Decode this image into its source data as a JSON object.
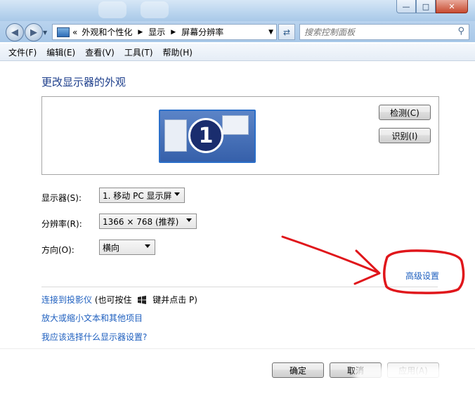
{
  "address": {
    "prefix": "«",
    "crumbs": [
      "外观和个性化",
      "显示",
      "屏幕分辨率"
    ]
  },
  "search": {
    "placeholder": "搜索控制面板"
  },
  "menu": [
    "文件(F)",
    "编辑(E)",
    "查看(V)",
    "工具(T)",
    "帮助(H)"
  ],
  "page_title": "更改显示器的外观",
  "preview": {
    "monitor_number": "1",
    "detect_label": "检测(C)",
    "identify_label": "识别(I)"
  },
  "fields": {
    "display_label": "显示器(S):",
    "display_value": "1. 移动 PC 显示屏",
    "resolution_label": "分辨率(R):",
    "resolution_value": "1366 × 768 (推荐)",
    "orientation_label": "方向(O):",
    "orientation_value": "横向"
  },
  "advanced_link": "高级设置",
  "links": {
    "projector": "连接到投影仪",
    "projector_hint_a": "(也可按住",
    "projector_hint_b": "键并点击 P)",
    "text_size": "放大或缩小文本和其他项目",
    "which_settings": "我应该选择什么显示器设置?"
  },
  "buttons": {
    "ok": "确定",
    "cancel": "取消",
    "apply": "应用(A)"
  },
  "colors": {
    "link": "#1e5fbf",
    "title": "#1e3f8c",
    "annotation": "#e0161b"
  }
}
